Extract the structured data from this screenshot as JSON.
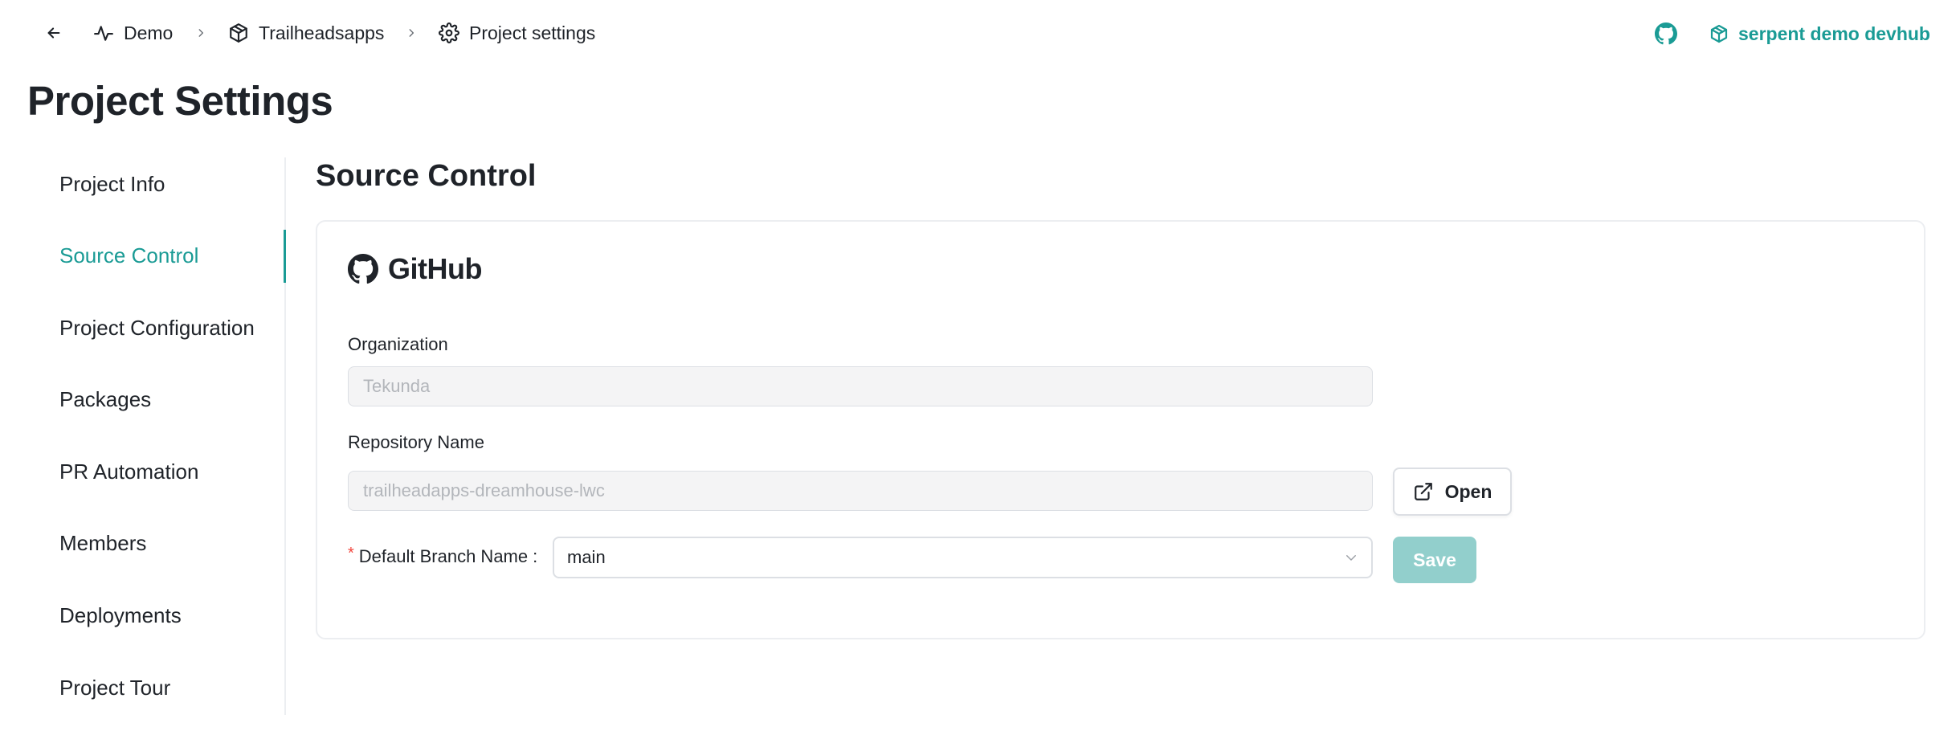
{
  "breadcrumbs": [
    {
      "label": "Demo",
      "icon": "activity-icon"
    },
    {
      "label": "Trailheadsapps",
      "icon": "package-icon"
    },
    {
      "label": "Project settings",
      "icon": "gear-icon"
    }
  ],
  "header": {
    "org_name": "serpent demo devhub"
  },
  "page_title": "Project Settings",
  "sidebar": {
    "items": [
      {
        "label": "Project Info",
        "active": false
      },
      {
        "label": "Source Control",
        "active": true
      },
      {
        "label": "Project Configuration",
        "active": false
      },
      {
        "label": "Packages",
        "active": false
      },
      {
        "label": "PR Automation",
        "active": false
      },
      {
        "label": "Members",
        "active": false
      },
      {
        "label": "Deployments",
        "active": false
      },
      {
        "label": "Project Tour",
        "active": false
      }
    ]
  },
  "main": {
    "section_title": "Source Control",
    "provider": "GitHub",
    "organization": {
      "label": "Organization",
      "value": "Tekunda"
    },
    "repository": {
      "label": "Repository Name",
      "value": "trailheadapps-dreamhouse-lwc",
      "open_label": "Open"
    },
    "branch": {
      "required_mark": "*",
      "label": "Default Branch Name",
      "colon": ":",
      "value": "main",
      "save_label": "Save"
    }
  },
  "colors": {
    "accent": "#1a9b95",
    "save_disabled": "#92cfcc",
    "required": "#f2453d",
    "input_disabled_bg": "#f4f4f5"
  }
}
